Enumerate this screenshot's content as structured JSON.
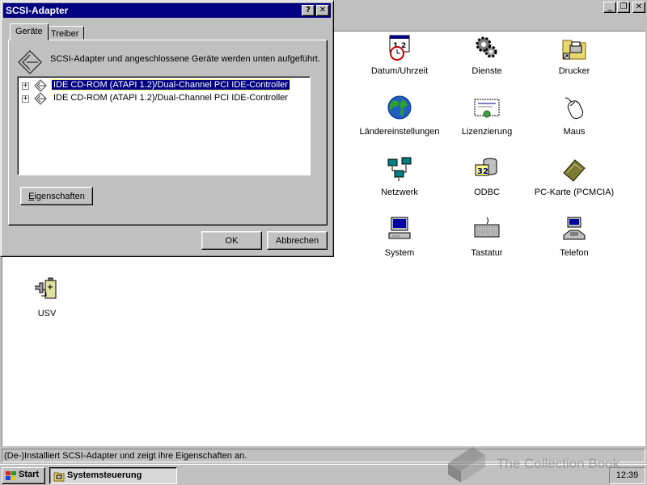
{
  "dialog": {
    "title": "SCSI-Adapter",
    "help_btn": "?",
    "close_btn": "✕",
    "tabs": [
      {
        "label": "Geräte",
        "active": true
      },
      {
        "label": "Treiber",
        "active": false
      }
    ],
    "description": "SCSI-Adapter und angeschlossene Geräte werden unten aufgeführt.",
    "tree_items": [
      {
        "label": "IDE CD-ROM (ATAPI 1.2)/Dual-Channel PCI IDE-Controller",
        "expander": "+",
        "selected": true
      },
      {
        "label": "IDE CD-ROM (ATAPI 1.2)/Dual-Channel PCI IDE-Controller",
        "expander": "+",
        "selected": false
      }
    ],
    "properties_button": {
      "accesskey": "E",
      "rest": "igenschaften"
    },
    "ok_button": "OK",
    "cancel_button": "Abbrechen"
  },
  "control_panel": {
    "window_buttons": [
      "_",
      "❐",
      "✕"
    ],
    "icons": [
      {
        "name": "datum-uhrzeit",
        "label": "Datum/Uhrzeit",
        "icon": "calendar-clock-icon"
      },
      {
        "name": "dienste",
        "label": "Dienste",
        "icon": "gears-icon"
      },
      {
        "name": "drucker",
        "label": "Drucker",
        "icon": "printer-folder-icon"
      },
      {
        "name": "laendereinstellungen",
        "label": "Ländereinstellungen",
        "icon": "globe-icon"
      },
      {
        "name": "lizenzierung",
        "label": "Lizenzierung",
        "icon": "certificate-icon"
      },
      {
        "name": "maus",
        "label": "Maus",
        "icon": "mouse-icon"
      },
      {
        "name": "netzwerk",
        "label": "Netzwerk",
        "icon": "network-icon"
      },
      {
        "name": "odbc",
        "label": "ODBC",
        "icon": "odbc-icon"
      },
      {
        "name": "pc-karte",
        "label": "PC-Karte (PCMCIA)",
        "icon": "pc-card-icon"
      },
      {
        "name": "system",
        "label": "System",
        "icon": "computer-icon"
      },
      {
        "name": "tastatur",
        "label": "Tastatur",
        "icon": "keyboard-icon"
      },
      {
        "name": "telefon",
        "label": "Telefon",
        "icon": "telephone-icon"
      },
      {
        "name": "usv",
        "label": "USV",
        "icon": "ups-battery-icon"
      }
    ]
  },
  "statusbar": {
    "text": "(De-)Installiert SCSI-Adapter und zeigt ihre Eigenschaften an."
  },
  "taskbar": {
    "start_label": "Start",
    "task_label": "Systemsteuerung",
    "clock": "12:39"
  },
  "watermark": {
    "text": "The Collection Book"
  },
  "colors": {
    "title_active": "#000080",
    "face": "#c0c0c0",
    "selection": "#000080"
  }
}
